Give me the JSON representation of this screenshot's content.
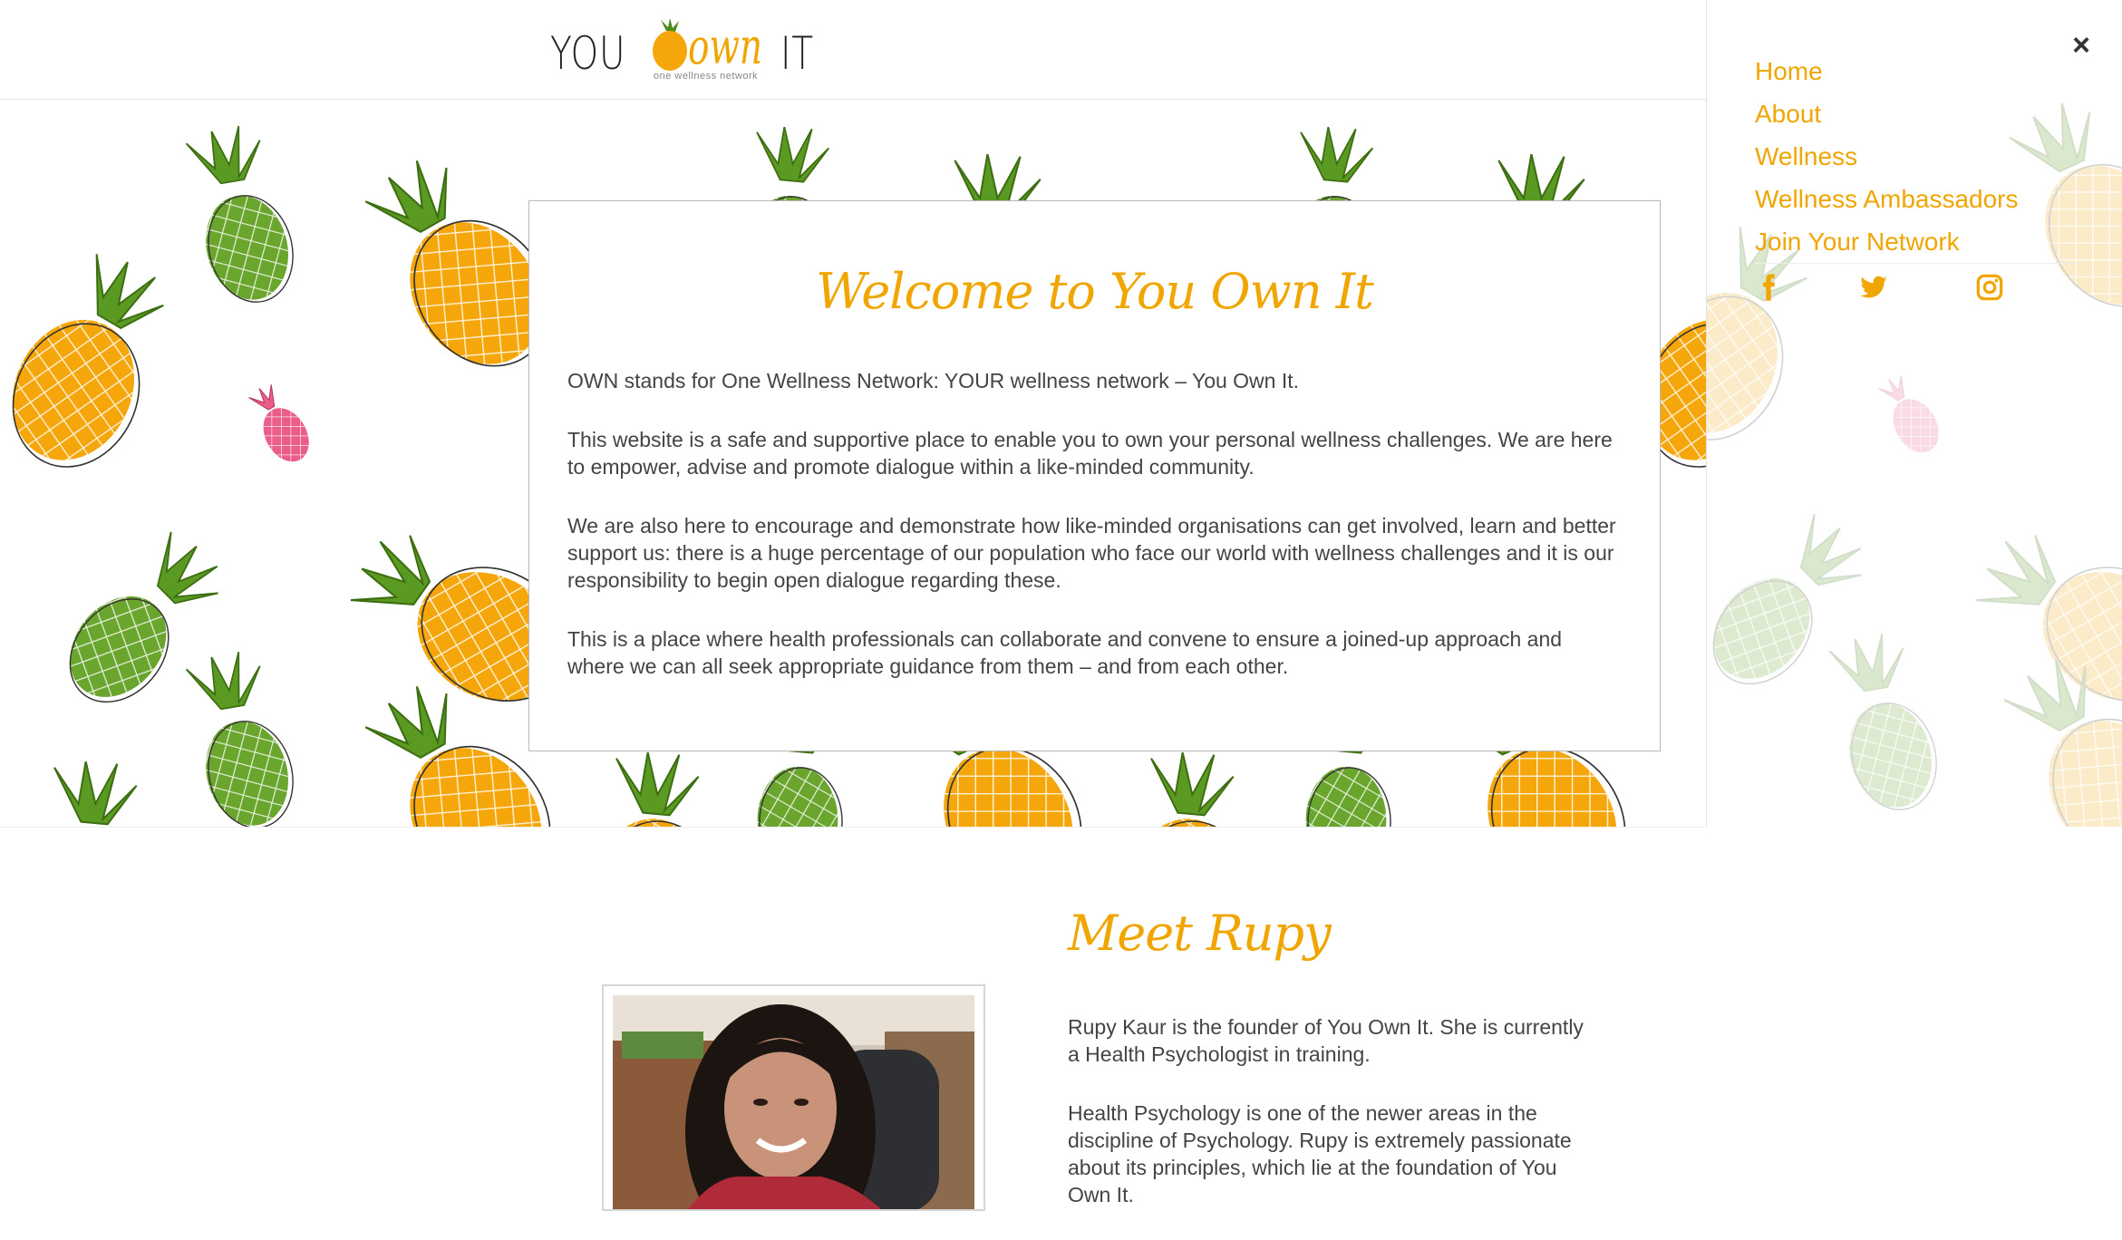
{
  "brand": {
    "logo_you": "YOU",
    "logo_own": "own",
    "logo_it": "IT",
    "logo_tagline": "one wellness network",
    "accent": "#f0a500"
  },
  "welcome": {
    "title": "Welcome to You Own It",
    "paragraphs": [
      "OWN stands for One Wellness Network: YOUR wellness network – You Own It.",
      "This website is a safe and supportive place to enable you to own your personal wellness challenges. We are here to empower, advise and promote dialogue within a like-minded community.",
      "We are also here to encourage and demonstrate how like-minded organisations can get involved, learn and better support us: there is a huge percentage of our population who face our world with wellness challenges and it is our responsibility to begin open dialogue regarding these.",
      "This is a place where health professionals can collaborate and convene to ensure a joined-up approach and where we can all seek appropriate guidance from them – and from each other."
    ]
  },
  "meet": {
    "title": "Meet Rupy",
    "paragraphs": [
      "Rupy Kaur is the founder of You Own It. She is currently a Health Psychologist in training.",
      "Health Psychology is one of the newer areas in the discipline of Psychology. Rupy is extremely passionate about its principles, which lie at the foundation of You Own It."
    ]
  },
  "menu": {
    "close_icon": "×",
    "items": [
      "Home",
      "About",
      "Wellness",
      "Wellness Ambassadors",
      "Join Your Network"
    ],
    "social_icons": [
      "facebook-icon",
      "twitter-icon",
      "instagram-icon"
    ]
  },
  "colors": {
    "pineapple_yellow": "#f5a60a",
    "pineapple_green": "#6aa52e",
    "pineapple_pink": "#ec5e8a",
    "leaf_green": "#4f8a1c"
  }
}
